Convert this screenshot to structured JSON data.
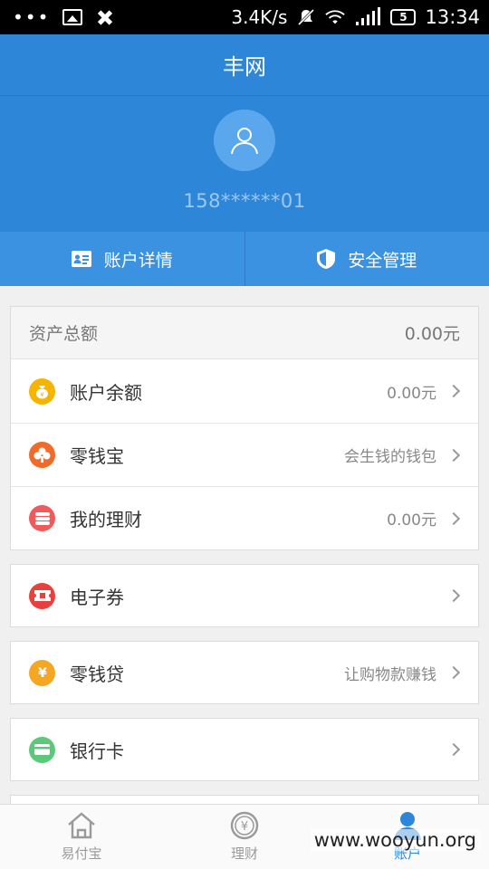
{
  "status_bar": {
    "speed": "3.4K/s",
    "battery": "5",
    "time": "13:34"
  },
  "title": "丰网",
  "profile": {
    "phone": "158******01"
  },
  "actions": [
    {
      "label": "账户详情",
      "icon": "id-card-icon"
    },
    {
      "label": "安全管理",
      "icon": "shield-icon"
    }
  ],
  "assets": {
    "header_label": "资产总额",
    "header_value": "0.00元",
    "rows": [
      {
        "label": "账户余额",
        "value": "0.00元",
        "icon": "money-bag-icon",
        "color": "#f5b400"
      },
      {
        "label": "零钱宝",
        "value": "会生钱的钱包",
        "icon": "coins-icon",
        "color": "#f06a2a"
      },
      {
        "label": "我的理财",
        "value": "0.00元",
        "icon": "stack-coins-icon",
        "color": "#ef5a5a"
      }
    ]
  },
  "coupon": {
    "label": "电子券",
    "icon": "ticket-icon",
    "color": "#e8403f"
  },
  "loan": {
    "label": "零钱贷",
    "value": "让购物款赚钱",
    "icon": "loan-icon",
    "color": "#f5a623"
  },
  "bankcard": {
    "label": "银行卡",
    "icon": "bank-card-icon",
    "color": "#5cc87a"
  },
  "nav": [
    {
      "label": "易付宝",
      "icon": "home-icon",
      "active": false
    },
    {
      "label": "理财",
      "icon": "yen-circle-icon",
      "active": false
    },
    {
      "label": "账户",
      "icon": "user-icon",
      "active": true
    }
  ],
  "watermark": "www.wooyun.org",
  "colors": {
    "primary": "#2e86d9",
    "background": "#f0f0f0"
  }
}
